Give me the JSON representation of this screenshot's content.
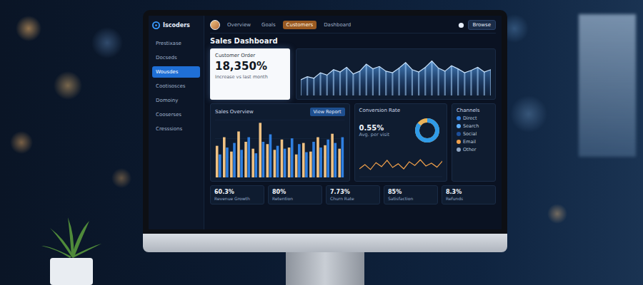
{
  "sidebar": {
    "logo": "Iscoders",
    "items": [
      {
        "label": "Prestixase",
        "selected": false
      },
      {
        "label": "Docseds",
        "selected": false
      },
      {
        "label": "Wousdes",
        "selected": true
      },
      {
        "label": "Cootisosces",
        "selected": false
      },
      {
        "label": "Domoiny",
        "selected": false
      },
      {
        "label": "Cooserses",
        "selected": false
      },
      {
        "label": "Cresssions",
        "selected": false
      }
    ]
  },
  "topbar": {
    "tabs": [
      {
        "label": "Overview",
        "selected": false
      },
      {
        "label": "Goals",
        "selected": false
      },
      {
        "label": "Customers",
        "selected": true
      },
      {
        "label": "Dashboard",
        "selected": false
      }
    ],
    "button": "Browse"
  },
  "title": "Sales Dashboard",
  "stat_card": {
    "label": "Customer Order",
    "value": "18,350%",
    "note": "Increase vs last month"
  },
  "area_chart": {
    "values": [
      40,
      48,
      44,
      58,
      52,
      66,
      60,
      72,
      55,
      62,
      80,
      68,
      74,
      62,
      58,
      70,
      84,
      66,
      60,
      72,
      88,
      70,
      62,
      76,
      68,
      58,
      64,
      72,
      60,
      66
    ]
  },
  "bar_chart": {
    "title": "Sales Overview",
    "button": "View Report",
    "series": [
      {
        "color": "#f0c283",
        "values": [
          55,
          70,
          45,
          80,
          62,
          50,
          95,
          58,
          48,
          66,
          52,
          40,
          60,
          45,
          70,
          56,
          76,
          50
        ]
      },
      {
        "color": "#2f7fe0",
        "values": [
          40,
          52,
          60,
          48,
          70,
          42,
          62,
          75,
          55,
          50,
          68,
          58,
          44,
          62,
          52,
          66,
          60,
          70
        ]
      }
    ]
  },
  "donut_panel": {
    "title": "Conversion Rate",
    "value": "0.55%",
    "label": "Avg. per visit",
    "level": 0.85,
    "line": [
      30,
      45,
      28,
      52,
      38,
      60,
      35,
      48,
      30,
      55,
      42,
      62,
      40,
      50,
      36,
      58
    ]
  },
  "legend": {
    "title": "Channels",
    "items": [
      {
        "label": "Direct",
        "color": "#2f7fe0"
      },
      {
        "label": "Search",
        "color": "#5fb0ff"
      },
      {
        "label": "Social",
        "color": "#1d4f9a"
      },
      {
        "label": "Email",
        "color": "#f0a04b"
      },
      {
        "label": "Other",
        "color": "#8fa6c4"
      }
    ]
  },
  "kpis": [
    {
      "value": "60.3%",
      "label": "Revenue Growth"
    },
    {
      "value": "80%",
      "label": "Retention"
    },
    {
      "value": "7.73%",
      "label": "Churn Rate"
    },
    {
      "value": "85%",
      "label": "Satisfaction"
    },
    {
      "value": "8.3%",
      "label": "Refunds"
    }
  ]
}
